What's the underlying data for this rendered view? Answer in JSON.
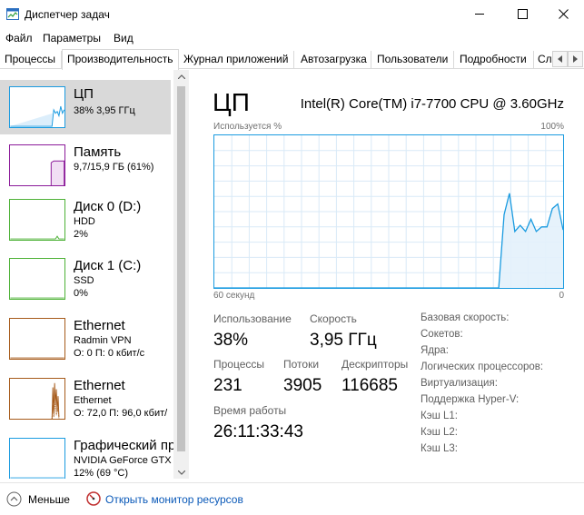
{
  "window": {
    "title": "Диспетчер задач"
  },
  "menu": [
    "Файл",
    "Параметры",
    "Вид"
  ],
  "tabs": [
    "Процессы",
    "Производительность",
    "Журнал приложений",
    "Автозагрузка",
    "Пользователи",
    "Подробности",
    "Сл"
  ],
  "active_tab": 1,
  "sidebar": {
    "items": [
      {
        "name": "ЦП",
        "line1": "38% 3,95 ГГц",
        "line2": "",
        "color": "#1a9be0"
      },
      {
        "name": "Память",
        "line1": "9,7/15,9 ГБ (61%)",
        "line2": "",
        "color": "#8b1a99"
      },
      {
        "name": "Диск 0 (D:)",
        "line1": "HDD",
        "line2": "2%",
        "color": "#4db136"
      },
      {
        "name": "Диск 1 (C:)",
        "line1": "SSD",
        "line2": "0%",
        "color": "#4db136"
      },
      {
        "name": "Ethernet",
        "line1": "Radmin VPN",
        "line2": "О: 0 П: 0 кбит/с",
        "color": "#a65a1a"
      },
      {
        "name": "Ethernet",
        "line1": "Ethernet",
        "line2": "О: 72,0 П: 96,0 кбит/",
        "color": "#a65a1a"
      },
      {
        "name": "Графический пр",
        "line1": "NVIDIA GeForce GTX",
        "line2": "12% (69 °C)",
        "color": "#1a9be0"
      }
    ]
  },
  "main": {
    "title": "ЦП",
    "cpu_model": "Intel(R) Core(TM) i7-7700 CPU @ 3.60GHz",
    "graph": {
      "ylabel": "Используется %",
      "ymax_label": "100%",
      "xleft_label": "60 секунд",
      "xright_label": "0",
      "color": "#1a9be0",
      "usage_percent": [
        0,
        0,
        0,
        0,
        0,
        0,
        0,
        0,
        0,
        0,
        0,
        0,
        0,
        0,
        0,
        0,
        0,
        0,
        0,
        0,
        0,
        0,
        0,
        0,
        0,
        0,
        0,
        0,
        0,
        0,
        0,
        0,
        0,
        0,
        0,
        0,
        0,
        0,
        0,
        0,
        0,
        0,
        0,
        0,
        0,
        0,
        0,
        0,
        0,
        0,
        0,
        0,
        0,
        0,
        48,
        62,
        37,
        41,
        37,
        45,
        37,
        40,
        40,
        52,
        55,
        38
      ]
    },
    "stats": {
      "usage_label": "Использование",
      "usage_value": "38%",
      "speed_label": "Скорость",
      "speed_value": "3,95 ГГц",
      "processes_label": "Процессы",
      "processes_value": "231",
      "threads_label": "Потоки",
      "threads_value": "3905",
      "handles_label": "Дескрипторы",
      "handles_value": "116685",
      "uptime_label": "Время работы",
      "uptime_value": "26:11:33:43"
    },
    "specs": [
      "Базовая скорость:",
      "Сокетов:",
      "Ядра:",
      "Логических процессоров:",
      "Виртуализация:",
      "Поддержка Hyper-V:",
      "Кэш L1:",
      "Кэш L2:",
      "Кэш L3:"
    ]
  },
  "footer": {
    "less": "Меньше",
    "monitor": "Открыть монитор ресурсов"
  }
}
